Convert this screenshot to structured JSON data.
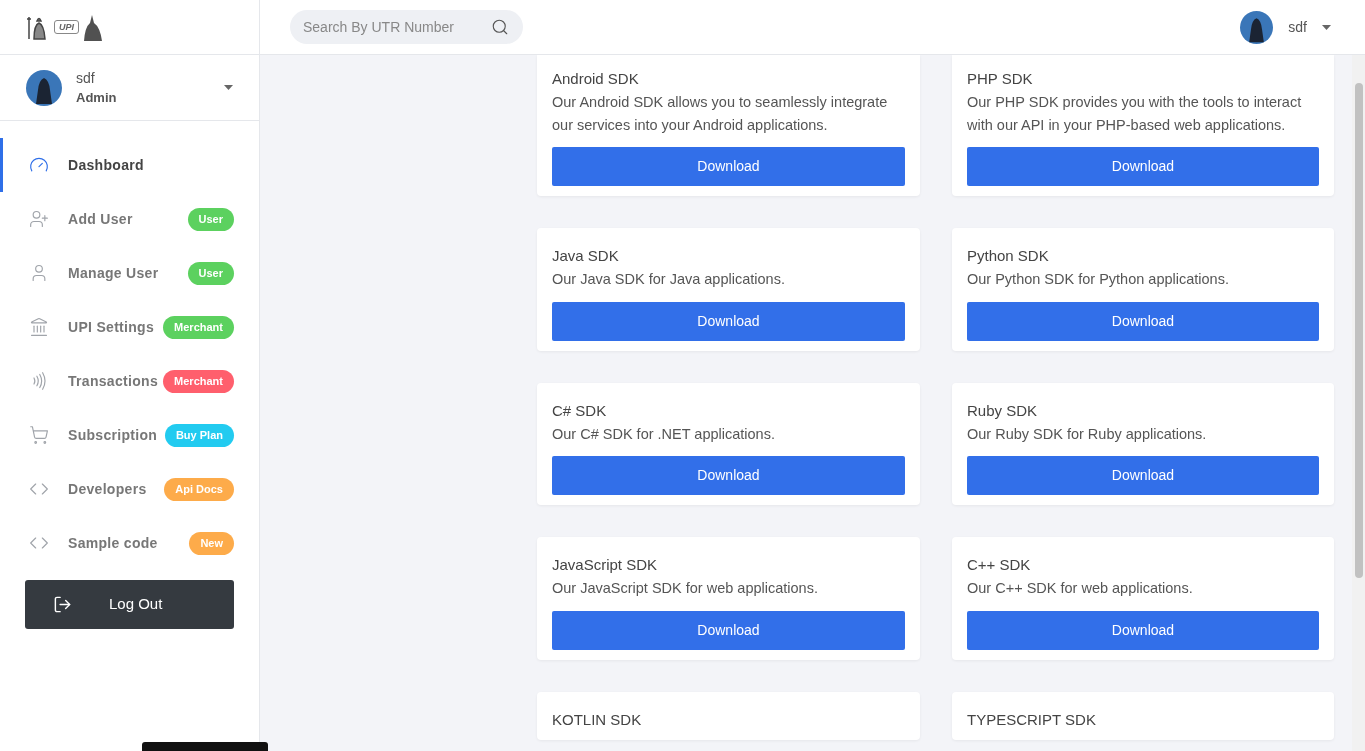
{
  "logo": {
    "text": "UPI"
  },
  "search": {
    "placeholder": "Search By UTR Number"
  },
  "header_user": {
    "name": "sdf"
  },
  "sidebar": {
    "user": {
      "name": "sdf",
      "role": "Admin"
    },
    "items": [
      {
        "label": "Dashboard",
        "selected": true
      },
      {
        "label": "Add User",
        "badge": "User",
        "color": "#5cd15f",
        "selected": false
      },
      {
        "label": "Manage User",
        "badge": "User",
        "color": "#5cd15f",
        "selected": false
      },
      {
        "label": "UPI Settings",
        "badge": "Merchant",
        "color": "#5cd15f",
        "selected": false
      },
      {
        "label": "Transactions",
        "badge": "Merchant",
        "color": "#ff5f6d",
        "selected": false
      },
      {
        "label": "Subscription",
        "badge": "Buy Plan",
        "color": "#22cbf0",
        "selected": false
      },
      {
        "label": "Developers",
        "badge": "Api Docs",
        "color": "#fdab4a",
        "selected": false
      },
      {
        "label": "Sample code",
        "badge": "New",
        "color": "#fdab4a",
        "selected": false
      }
    ],
    "logout": "Log Out"
  },
  "sdks": [
    {
      "title": "Android SDK",
      "description": "Our Android SDK allows you to seamlessly integrate our services into your Android applications.",
      "button": "Download"
    },
    {
      "title": "PHP SDK",
      "description": "Our PHP SDK provides you with the tools to interact with our API in your PHP-based web applications.",
      "button": "Download"
    },
    {
      "title": "Java SDK",
      "description": "Our Java SDK for Java applications.",
      "button": "Download"
    },
    {
      "title": "Python SDK",
      "description": "Our Python SDK for Python applications.",
      "button": "Download"
    },
    {
      "title": "C# SDK",
      "description": "Our C# SDK for .NET applications.",
      "button": "Download"
    },
    {
      "title": "Ruby SDK",
      "description": "Our Ruby SDK for Ruby applications.",
      "button": "Download"
    },
    {
      "title": "JavaScript SDK",
      "description": "Our JavaScript SDK for web applications.",
      "button": "Download"
    },
    {
      "title": "C++ SDK",
      "description": "Our C++ SDK for web applications.",
      "button": "Download"
    },
    {
      "title": "KOTLIN SDK"
    },
    {
      "title": "TYPESCRIPT SDK"
    }
  ]
}
